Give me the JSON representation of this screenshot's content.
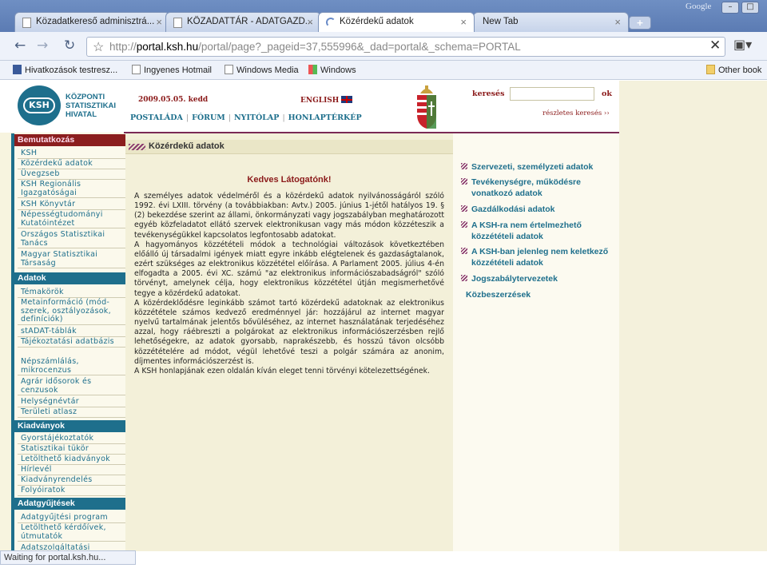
{
  "browser": {
    "tabs": [
      {
        "label": "Közadatkereső adminisztrá..."
      },
      {
        "label": "KÖZADATTÁR - ADATGAZD..."
      },
      {
        "label": "Közérdekű adatok"
      },
      {
        "label": "New Tab"
      }
    ],
    "google_label": "Google",
    "url_host": "portal.ksh.hu",
    "url_prefix": "http://",
    "url_rest": "/portal/page?_pageid=37,555996&_dad=portal&_schema=PORTAL",
    "bookmarks": [
      {
        "label": "Hivatkozások testresz...",
        "icon": "msn-icon"
      },
      {
        "label": "Ingyenes Hotmail",
        "icon": "page-icon"
      },
      {
        "label": "Windows Media",
        "icon": "page-icon"
      },
      {
        "label": "Windows",
        "icon": "windows-icon"
      }
    ],
    "other_bookmarks": "Other book",
    "status": "Waiting for portal.ksh.hu..."
  },
  "header": {
    "logo_text": "KSH",
    "org_name": "KÖZPONTI STATISZTIKAI HIVATAL",
    "date": "2009.05.05. kedd",
    "lang": "ENGLISH",
    "nav": [
      "POSTALÁDA",
      "FÓRUM",
      "NYITÓLAP",
      "HONLAPTÉRKÉP"
    ],
    "search_label": "keresés",
    "search_button": "ok",
    "advanced_search": "részletes keresés ››"
  },
  "sidebar": {
    "sections": [
      {
        "title": "Bemutatkozás",
        "items": [
          "KSH",
          "Közérdekű adatok",
          "Üvegzseb",
          "KSH Regionális Igazgatóságai",
          "KSH Könyvtár",
          "Népességtudományi Kutatóintézet",
          "Országos Statisztikai Tanács",
          "Magyar Statisztikai Társaság"
        ]
      },
      {
        "title": "Adatok",
        "items": [
          "Témakörök",
          "Metainformáció (mód-szerek, osztályozások, definíciók)",
          "stADAT-táblák",
          "Tájékoztatási adatbázis",
          "Népszámlálás, mikrocenzus",
          "Agrár idősorok és cenzusok",
          "Helységnévtár",
          "Területi atlasz"
        ]
      },
      {
        "title": "Kiadványok",
        "items": [
          "Gyorstájékoztatók",
          "Statisztikai tükör",
          "Letölthető kiadványok",
          "Hírlevél",
          "Kiadványrendelés",
          "Folyóiratok"
        ]
      },
      {
        "title": "Adatgyűjtések",
        "items": [
          "Adatgyűjtési program",
          "Letölthető kérdőívek, útmutatók",
          "Adatszolgáltatási"
        ]
      }
    ]
  },
  "main": {
    "title": "Közérdekű adatok",
    "greeting": "Kedves Látogatónk!",
    "paragraphs": [
      "A személyes adatok védelméről és a közérdekű adatok nyilvánosságáról szóló 1992. évi LXIII. törvény (a továbbiakban: Avtv.) 2005. június 1-jétől hatályos 19. § (2) bekezdése szerint az állami, önkormányzati vagy jogszabályban meghatározott egyéb közfeladatot ellátó szervek elektronikusan vagy más módon közzéteszik a tevékenységükkel kapcsolatos legfontosabb adatokat.",
      "A hagyományos közzétételi módok a technológiai változások következtében előálló új társadalmi igények miatt egyre inkább elégtelenek és gazdaságtalanok, ezért szükséges az elektronikus közzététel előírása. A Parlament 2005. július 4-én elfogadta a 2005. évi XC. számú \"az elektronikus információszabadságról\" szóló törvényt, amelynek célja, hogy elektronikus közzététel útján megismerhetővé tegye a közérdekű adatokat.",
      "A közérdeklődésre leginkább számot tartó közérdekű adatoknak az elektronikus közzététele számos kedvező eredménnyel jár: hozzájárul az internet magyar nyelvű tartalmának jelentős bővüléséhez, az internet használatának terjedéséhez azzal, hogy ráébreszti a polgárokat az elektronikus információszerzésben rejlő lehetőségekre, az adatok gyorsabb, naprakészebb, és hosszú távon olcsóbb közzétételére ad módot, végül lehetővé teszi a polgár számára az anonim, díjmentes információszerzést is.",
      "A KSH honlapjának ezen oldalán kíván eleget tenni törvényi kötelezettségének."
    ]
  },
  "right": {
    "links": [
      "Szervezeti, személyzeti adatok",
      "Tevékenységre, működésre vonatkozó adatok",
      "Gazdálkodási adatok",
      "A KSH-ra nem értelmezhető közzétételi adatok",
      "A KSH-ban jelenleg nem keletkező közzétételi adatok",
      "Jogszabálytervezetek"
    ],
    "procurement": "Közbeszerzések"
  }
}
